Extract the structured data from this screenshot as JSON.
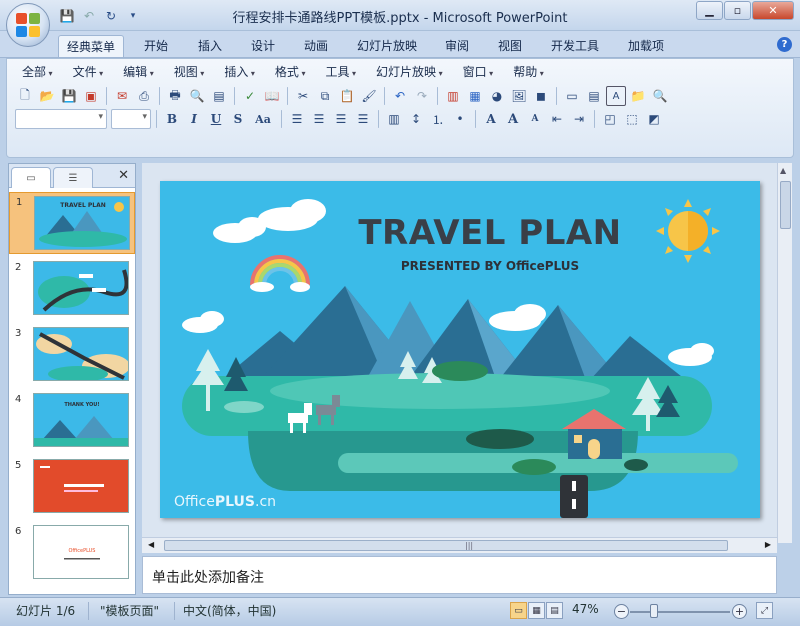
{
  "window": {
    "title": "行程安排卡通路线PPT模板.pptx - Microsoft PowerPoint",
    "controls": [
      "minimize",
      "maximize",
      "close"
    ]
  },
  "quick_access": [
    "save-icon",
    "undo-icon",
    "redo-icon",
    "customize-icon"
  ],
  "ribbon_tabs": [
    "经典菜单",
    "开始",
    "插入",
    "设计",
    "动画",
    "幻灯片放映",
    "审阅",
    "视图",
    "开发工具",
    "加载项"
  ],
  "active_tab": "经典菜单",
  "classic_menu": [
    "全部",
    "文件",
    "编辑",
    "视图",
    "插入",
    "格式",
    "工具",
    "幻灯片放映",
    "窗口",
    "帮助"
  ],
  "format_buttons": {
    "bold": "B",
    "italic": "I",
    "underline": "U",
    "strike": "S",
    "case": "Aa"
  },
  "slides_panel": {
    "tabs": [
      "slides-tab",
      "outline-tab"
    ],
    "thumbnails": [
      {
        "num": "1",
        "label": "TRAVEL PLAN",
        "theme": "blue"
      },
      {
        "num": "2",
        "label": "",
        "theme": "blue"
      },
      {
        "num": "3",
        "label": "",
        "theme": "blue"
      },
      {
        "num": "4",
        "label": "THANK YOU!",
        "theme": "blue"
      },
      {
        "num": "5",
        "label": "",
        "theme": "red"
      },
      {
        "num": "6",
        "label": "OfficePLUS",
        "theme": "white"
      }
    ],
    "selected": 1
  },
  "slide": {
    "title": "TRAVEL PLAN",
    "subtitle": "PRESENTED BY OfficePLUS",
    "footer_light": "Office",
    "footer_bold": "PLUS",
    "footer_suffix": ".cn",
    "colors": {
      "sky": "#3bbbe8",
      "mountain_dark": "#2a6e93",
      "mountain_light": "#4a97bf",
      "land": "#2fb9a8",
      "land_dark": "#27988f",
      "road": "#2f3338",
      "house_roof": "#e8736e",
      "sun": "#f7c548"
    }
  },
  "notes": {
    "placeholder": "单击此处添加备注"
  },
  "status": {
    "slide_info": "幻灯片 1/6",
    "theme": "\"模板页面\"",
    "language": "中文(简体，中国)",
    "zoom": "47%"
  }
}
